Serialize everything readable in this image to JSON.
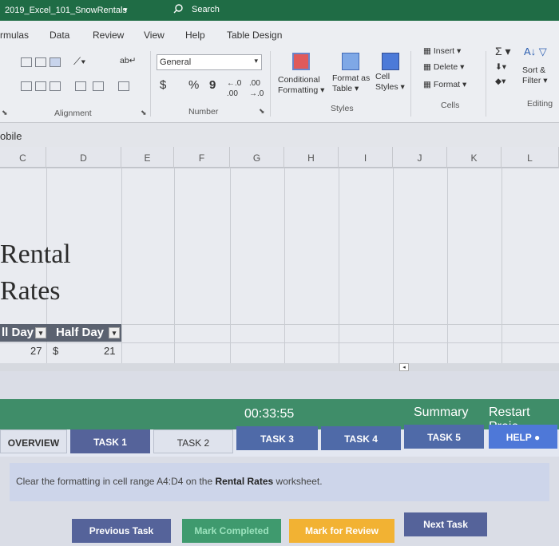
{
  "title": {
    "file": "2019_Excel_101_SnowRentals",
    "search": "Search"
  },
  "menu": [
    "rmulas",
    "Data",
    "Review",
    "View",
    "Help",
    "Table Design"
  ],
  "ribbon": {
    "number_format": "General",
    "currency": "$",
    "percent": "%",
    "comma": "9",
    "cond_fmt": [
      "Conditional",
      "Formatting"
    ],
    "fmt_table": [
      "Format as",
      "Table"
    ],
    "cell_styles": [
      "Cell",
      "Styles"
    ],
    "insert": "Insert",
    "delete": "Delete",
    "format": "Format",
    "sort_filter": [
      "Sort &",
      "Filter"
    ],
    "groups": {
      "alignment": "Alignment",
      "number": "Number",
      "styles": "Styles",
      "cells": "Cells",
      "editing": "Editing"
    }
  },
  "name_box_partial": "obile",
  "columns": [
    "C",
    "D",
    "E",
    "F",
    "G",
    "H",
    "I",
    "J",
    "K",
    "L"
  ],
  "sheet": {
    "title_line1": "Rental",
    "title_line2": "Rates",
    "hdr_full": "ll Day",
    "hdr_half": "Half Day",
    "full_val": "27",
    "half_cur": "$",
    "half_val": "21"
  },
  "panel": {
    "timer": "00:33:55",
    "summary": "Summary",
    "restart": "Restart Proje",
    "tabs": [
      "OVERVIEW",
      "TASK 1",
      "TASK 2",
      "TASK 3",
      "TASK 4",
      "TASK 5",
      "HELP"
    ],
    "instruction_pre": "Clear the formatting in cell range A4:D4 on the",
    "instruction_bold": "Rental Rates",
    "instruction_post": "worksheet.",
    "buttons": {
      "prev": "Previous Task",
      "complete": "Mark Completed",
      "review": "Mark for Review",
      "next": "Next Task"
    }
  },
  "colors": {
    "excel_green": "#1f6c45",
    "task_bar": "#3f8d69",
    "tab_blue": "#4f6aa8",
    "review": "#f2b233"
  }
}
